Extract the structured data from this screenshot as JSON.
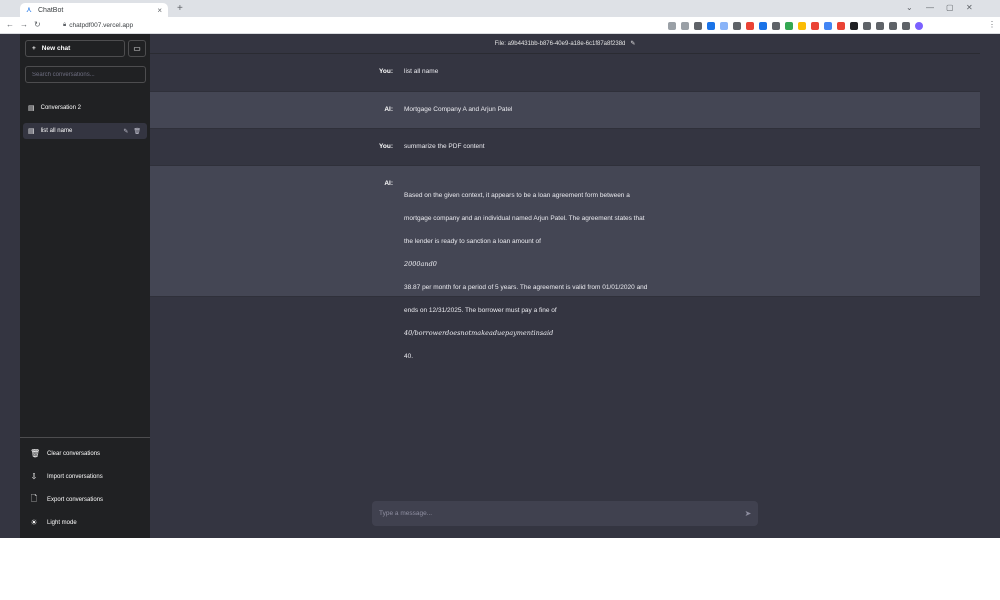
{
  "browser": {
    "tab_title": "ChatBot",
    "tab_close": "×",
    "new_tab": "+",
    "url": "chatpdf007.vercel.app",
    "window_controls": [
      "⌄",
      "—",
      "▢",
      "✕"
    ],
    "extensions": [
      {
        "icon": "share-icon",
        "color": "#9aa0a6"
      },
      {
        "icon": "star-icon",
        "color": "#9aa0a6"
      },
      {
        "icon": "ext-1-icon",
        "color": "#5f6368"
      },
      {
        "icon": "ext-2-icon",
        "color": "#1a73e8"
      },
      {
        "icon": "ext-3-icon",
        "color": "#8ab4f8"
      },
      {
        "icon": "ext-4-icon",
        "color": "#5f6368"
      },
      {
        "icon": "ext-5-icon",
        "color": "#ea4335"
      },
      {
        "icon": "ext-6-icon",
        "color": "#1a73e8"
      },
      {
        "icon": "ext-7-icon",
        "color": "#5f6368"
      },
      {
        "icon": "ext-8-icon",
        "color": "#34a853"
      },
      {
        "icon": "ext-9-icon",
        "color": "#fbbc04"
      },
      {
        "icon": "ext-10-icon",
        "color": "#ea4335"
      },
      {
        "icon": "ext-11-icon",
        "color": "#4285f4"
      },
      {
        "icon": "ext-12-icon",
        "color": "#ea4335"
      },
      {
        "icon": "ext-13-icon",
        "color": "#202124"
      },
      {
        "icon": "ext-14-icon",
        "color": "#5f6368"
      },
      {
        "icon": "ext-15-icon",
        "color": "#5f6368"
      },
      {
        "icon": "ext-16-icon",
        "color": "#5f6368"
      },
      {
        "icon": "ext-17-icon",
        "color": "#5f6368"
      },
      {
        "icon": "profile-avatar-icon",
        "color": "#7b61ff"
      }
    ],
    "menu_icon": "⋮"
  },
  "sidebar": {
    "new_chat_label": "New chat",
    "search_placeholder": "Search conversations...",
    "conversations": [
      {
        "title": "Conversation 2"
      },
      {
        "title": "list all name"
      }
    ],
    "actions": [
      {
        "label": "Clear conversations",
        "icon": "trash-icon"
      },
      {
        "label": "Import conversations",
        "icon": "import-icon"
      },
      {
        "label": "Export conversations",
        "icon": "file-export-icon"
      },
      {
        "label": "Light mode",
        "icon": "sun-icon"
      }
    ]
  },
  "main": {
    "file_header": "File: a9b4431bb-b876-40e9-a18e-6c1f87a8f238d",
    "messages": [
      {
        "role": "You:",
        "text": "list all name"
      },
      {
        "role": "AI:",
        "text": "Mortgage Company A and Arjun Patel"
      },
      {
        "role": "You:",
        "text": "summarize the PDF content"
      },
      {
        "role": "AI:",
        "lines": [
          "Based on the given context, it appears to be a loan agreement form between a",
          "mortgage company and an individual named Arjun Patel. The agreement states that",
          "the lender is ready to sanction a loan amount of",
          "2000and0",
          "38.87 per month for a period of 5 years. The agreement is valid from 01/01/2020 and",
          "ends on 12/31/2025. The borrower must pay a fine of",
          "40/borrowerdoesnotmakeaduepaymentinsaid",
          "40."
        ]
      }
    ],
    "input_placeholder": "Type a message...",
    "colors": {
      "sidebar_bg": "#202123",
      "chat_bg": "#343541",
      "ai_row_bg": "#444654",
      "input_bg": "#40414f"
    }
  }
}
